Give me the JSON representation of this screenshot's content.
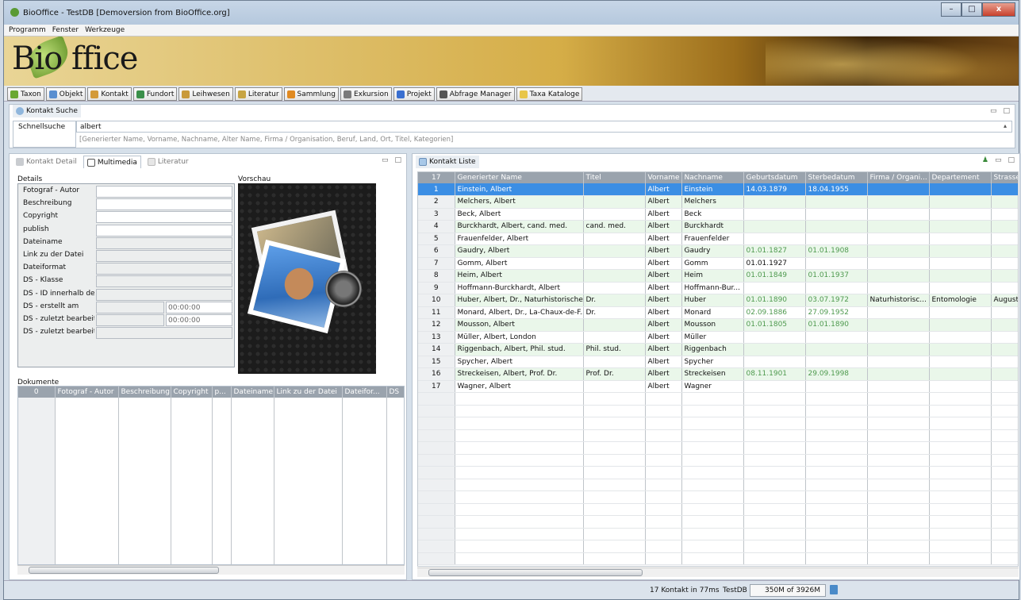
{
  "window": {
    "title": "BioOffice - TestDB [Demoversion from BioOffice.org]",
    "btn_min": "–",
    "btn_max": "□",
    "btn_close": "x"
  },
  "menu": [
    "Programm",
    "Fenster",
    "Werkzeuge"
  ],
  "banner": {
    "logo": "Bio ffice"
  },
  "toolbar": [
    {
      "label": "Taxon",
      "icon": "leaf-icon",
      "color": "#6aa832"
    },
    {
      "label": "Objekt",
      "icon": "box-icon",
      "color": "#5a8fd0"
    },
    {
      "label": "Kontakt",
      "icon": "person-icon",
      "color": "#d39a3a"
    },
    {
      "label": "Fundort",
      "icon": "globe-icon",
      "color": "#3a8f4a"
    },
    {
      "label": "Leihwesen",
      "icon": "handshake-icon",
      "color": "#c99a3a"
    },
    {
      "label": "Literatur",
      "icon": "book-icon",
      "color": "#c7a443"
    },
    {
      "label": "Sammlung",
      "icon": "drawer-icon",
      "color": "#e08a22"
    },
    {
      "label": "Exkursion",
      "icon": "bus-icon",
      "color": "#7a7a7a"
    },
    {
      "label": "Projekt",
      "icon": "flag-icon",
      "color": "#3a6fd0"
    },
    {
      "label": "Abfrage Manager",
      "icon": "binoculars-icon",
      "color": "#555"
    },
    {
      "label": "Taxa Kataloge",
      "icon": "folder-icon",
      "color": "#e8c64a"
    }
  ],
  "search_panel": {
    "title": "Kontakt Suche",
    "label": "Schnellsuche",
    "value": "albert",
    "hint": "[Generierter Name, Vorname, Nachname, Alter Name, Firma / Organisation, Beruf, Land, Ort, Titel, Kategorien]",
    "min": "▭",
    "max": "□"
  },
  "left_tabs": [
    "Kontakt Detail",
    "Multimedia",
    "Literatur"
  ],
  "details": {
    "title": "Details",
    "fields": [
      "Fotograf - Autor",
      "Beschreibung",
      "Copyright",
      "publish",
      "Dateiname",
      "Link zu der Datei",
      "Dateiformat",
      "DS - Klasse",
      "DS - ID innerhalb der",
      "DS - erstellt am",
      "DS - zuletzt bearbeit",
      "DS - zuletzt bearbeit"
    ],
    "time1": "00:00:00",
    "time2": "00:00:00"
  },
  "preview": {
    "title": "Vorschau"
  },
  "documents": {
    "title": "Dokumente",
    "count": "0",
    "columns": [
      "Fotograf - Autor",
      "Beschreibung",
      "Copyright",
      "p...",
      "Dateiname",
      "Link zu der Datei",
      "Dateifor...",
      "DS"
    ]
  },
  "list": {
    "title": "Kontakt Liste",
    "count": "17",
    "columns": [
      "Generierter Name",
      "Titel",
      "Vorname",
      "Nachname",
      "Geburtsdatum",
      "Sterbedatum",
      "Firma / Organi...",
      "Departement",
      "Strasse"
    ],
    "rows": [
      [
        "1",
        "Einstein, Albert",
        "",
        "Albert",
        "Einstein",
        "14.03.1879",
        "18.04.1955",
        "",
        "",
        ""
      ],
      [
        "2",
        "Melchers, Albert",
        "",
        "Albert",
        "Melchers",
        "",
        "",
        "",
        "",
        ""
      ],
      [
        "3",
        "Beck, Albert",
        "",
        "Albert",
        "Beck",
        "",
        "",
        "",
        "",
        ""
      ],
      [
        "4",
        "Burckhardt, Albert, cand. med.",
        "cand. med.",
        "Albert",
        "Burckhardt",
        "",
        "",
        "",
        "",
        ""
      ],
      [
        "5",
        "Frauenfelder, Albert",
        "",
        "Albert",
        "Frauenfelder",
        "",
        "",
        "",
        "",
        ""
      ],
      [
        "6",
        "Gaudry, Albert",
        "",
        "Albert",
        "Gaudry",
        "01.01.1827",
        "01.01.1908",
        "",
        "",
        ""
      ],
      [
        "7",
        "Gomm, Albert",
        "",
        "Albert",
        "Gomm",
        "01.01.1927",
        "",
        "",
        "",
        ""
      ],
      [
        "8",
        "Heim, Albert",
        "",
        "Albert",
        "Heim",
        "01.01.1849",
        "01.01.1937",
        "",
        "",
        ""
      ],
      [
        "9",
        "Hoffmann-Burckhardt, Albert",
        "",
        "Albert",
        "Hoffmann-Bur...",
        "",
        "",
        "",
        "",
        ""
      ],
      [
        "10",
        "Huber, Albert, Dr., Naturhistorische...",
        "Dr.",
        "Albert",
        "Huber",
        "01.01.1890",
        "03.07.1972",
        "Naturhistorisc...",
        "Entomologie",
        "August"
      ],
      [
        "11",
        "Monard, Albert, Dr., La-Chaux-de-F...",
        "Dr.",
        "Albert",
        "Monard",
        "02.09.1886",
        "27.09.1952",
        "",
        "",
        ""
      ],
      [
        "12",
        "Mousson, Albert",
        "",
        "Albert",
        "Mousson",
        "01.01.1805",
        "01.01.1890",
        "",
        "",
        ""
      ],
      [
        "13",
        "Müller, Albert, London",
        "",
        "Albert",
        "Müller",
        "",
        "",
        "",
        "",
        ""
      ],
      [
        "14",
        "Riggenbach, Albert, Phil. stud.",
        "Phil. stud.",
        "Albert",
        "Riggenbach",
        "",
        "",
        "",
        "",
        ""
      ],
      [
        "15",
        "Spycher, Albert",
        "",
        "Albert",
        "Spycher",
        "",
        "",
        "",
        "",
        ""
      ],
      [
        "16",
        "Streckeisen, Albert, Prof. Dr.",
        "Prof. Dr.",
        "Albert",
        "Streckeisen",
        "08.11.1901",
        "29.09.1998",
        "",
        "",
        ""
      ],
      [
        "17",
        "Wagner, Albert",
        "",
        "Albert",
        "Wagner",
        "",
        "",
        "",
        "",
        ""
      ]
    ]
  },
  "status": {
    "result": "17 Kontakt in 77ms",
    "db": "TestDB",
    "memory": "350M of 3926M"
  }
}
